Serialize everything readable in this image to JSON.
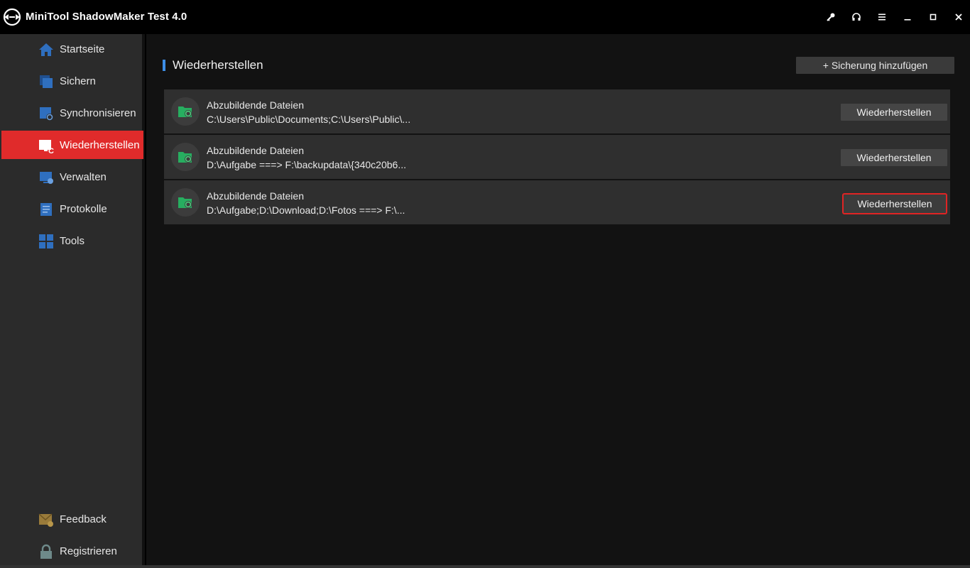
{
  "app": {
    "title": "MiniTool ShadowMaker Test 4.0"
  },
  "titlebar": {
    "buttons": [
      {
        "name": "key-icon"
      },
      {
        "name": "headset-icon"
      },
      {
        "name": "menu-icon"
      },
      {
        "name": "minimize-icon"
      },
      {
        "name": "maximize-icon"
      },
      {
        "name": "close-icon"
      }
    ]
  },
  "sidebar": {
    "items": [
      {
        "label": "Startseite",
        "icon": "home-icon"
      },
      {
        "label": "Sichern",
        "icon": "backup-icon"
      },
      {
        "label": "Synchronisieren",
        "icon": "sync-icon"
      },
      {
        "label": "Wiederherstellen",
        "icon": "restore-icon",
        "active": true
      },
      {
        "label": "Verwalten",
        "icon": "manage-icon"
      },
      {
        "label": "Protokolle",
        "icon": "log-icon"
      },
      {
        "label": "Tools",
        "icon": "tools-icon"
      }
    ],
    "bottom": [
      {
        "label": "Feedback",
        "icon": "feedback-icon"
      },
      {
        "label": "Registrieren",
        "icon": "lock-icon"
      }
    ]
  },
  "main": {
    "title": "Wiederherstellen",
    "add_button": "+ Sicherung hinzufügen",
    "tasks": [
      {
        "title": "Abzubildende Dateien",
        "path": "C:\\Users\\Public\\Documents;C:\\Users\\Public\\...",
        "button": "Wiederherstellen"
      },
      {
        "title": "Abzubildende Dateien",
        "path": "D:\\Aufgabe ===> F:\\backupdata\\{340c20b6...",
        "button": "Wiederherstellen"
      },
      {
        "title": "Abzubildende Dateien",
        "path": "D:\\Aufgabe;D:\\Download;D:\\Fotos ===> F:\\...",
        "button": "Wiederherstellen",
        "highlighted": true
      }
    ]
  },
  "colors": {
    "accent": "#e02b2b",
    "title_marker": "#3d8ee6",
    "icon_blue": "#2f6fbf",
    "icon_green": "#27ae60"
  }
}
